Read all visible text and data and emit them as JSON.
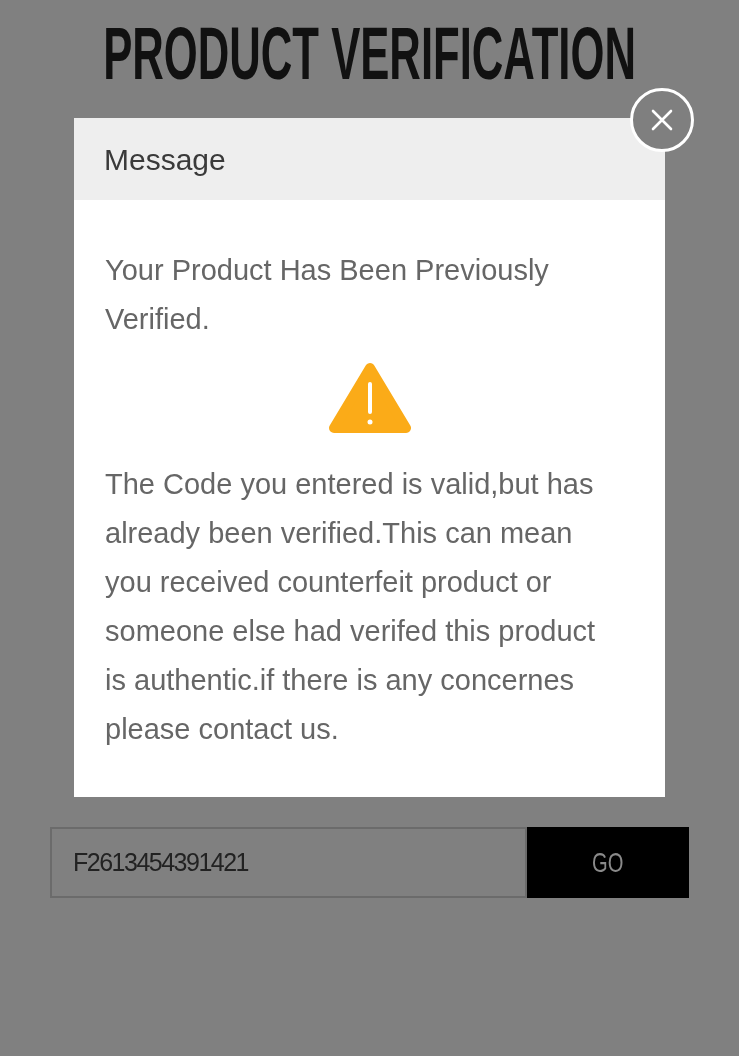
{
  "page": {
    "title": "PRODUCT VERIFICATION"
  },
  "dialog": {
    "title": "Message",
    "heading": "Your Product Has Been Previously Verified.",
    "message": "The Code you entered is valid,but has already been verified.This can mean you received counterfeit product or someone else had verifed this product is authentic.if there is any concernes please contact us."
  },
  "verification_form": {
    "code_field": {
      "value": "F2613454391421"
    },
    "submit_button": "GO"
  }
}
